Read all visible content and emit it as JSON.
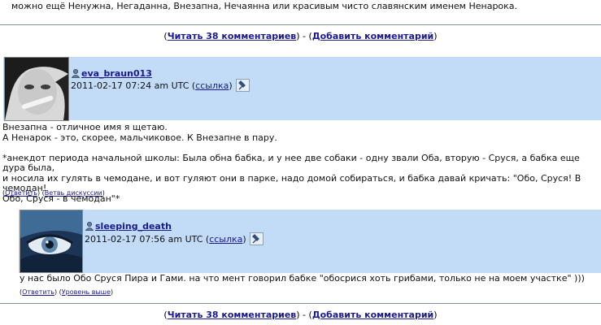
{
  "top_text": "можно ещё Ненужна, Негаданна, Внезапна, Нечаянна или красивым чисто славянским именем Ненарока.",
  "nav": {
    "read_label": "Читать 38 комментариев",
    "add_label": "Добавить комментарий",
    "open_paren": "(",
    "close_paren": ")",
    "separator": " - "
  },
  "comments": [
    {
      "username": "eva_braun013",
      "timestamp": "2011-02-17 07:24 am UTC",
      "link_label": "ссылка",
      "body": "Внезапна - отличное имя я щетаю.\nА Ненарок - это, скорее, мальчиковое. К Внезапне в пару.\n\n*анекдот периода начальной школы: Была обна бабка, и у нее две собаки - одну звали Оба, вторую - Сруся, а бабка еще дура была,\nи носила их гулять в чемодане, и вот гуляют они в парке, надо домой собираться, и бабка давай кричать: \"Обо, Сруся! В чемодан!\nОбо, Сруся - в чемодан\"*",
      "reply_label": "Ответить",
      "thread_label": "Ветвь дискуссии"
    },
    {
      "username": "sleeping_death",
      "timestamp": "2011-02-17 07:56 am UTC",
      "link_label": "ссылка",
      "body": "у нас было Обо Сруся Пира и Гами. на что мент говорил бабке \"обосрися хоть грибами, только не на моем участке\" )))",
      "reply_label": "Ответить",
      "up_label": "Уровень выше"
    }
  ],
  "colors": {
    "header_bg": "#c2dcf7",
    "link": "#1a1a8c",
    "rule": "#7f95a8"
  }
}
